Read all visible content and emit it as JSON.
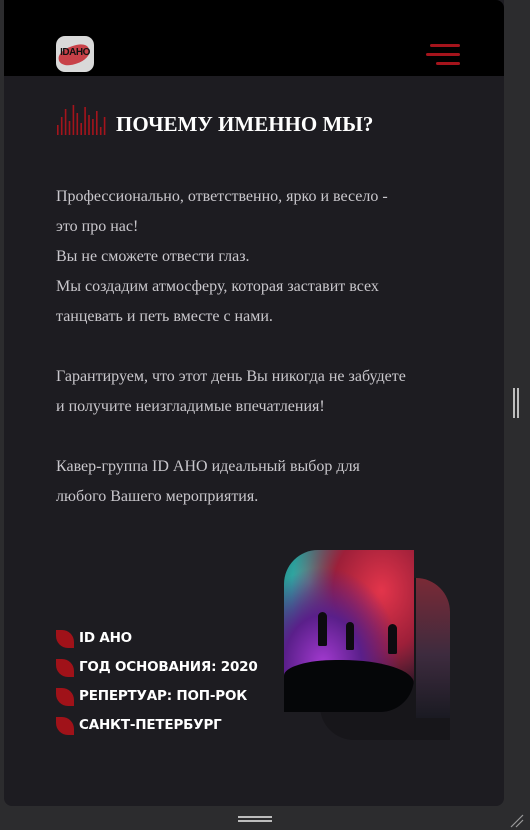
{
  "header": {
    "logo_text": "IDАНО",
    "menu_icon": "hamburger-menu-icon"
  },
  "section": {
    "icon": "equalizer-bars-icon",
    "title": "ПОЧЕМУ ИМЕННО МЫ?"
  },
  "paragraphs": [
    {
      "lines": [
        "Профессионально, ответственно, ярко и весело -",
        "это про нас!",
        "Вы не сможете отвести глаз.",
        "Мы создадим атмосферу, которая заставит всех",
        "танцевать и петь вместе с нами."
      ]
    },
    {
      "lines": [
        "Гарантируем, что этот день Вы никогда не забудете",
        "и получите неизгладимые впечатления!"
      ]
    },
    {
      "lines": [
        "Кавер-группа ID АНО идеальный выбор для",
        "любого Вашего мероприятия."
      ]
    }
  ],
  "facts": [
    "ID АНО",
    "ГОД ОСНОВАНИЯ: 2020",
    "РЕПЕРТУАР: ПОП-РОК",
    "САНКТ-ПЕТЕРБУРГ"
  ],
  "photo": {
    "icon": "concert-stage-photo"
  },
  "colors": {
    "accent": "#a5141c",
    "background": "#1d1c21",
    "header": "#000000",
    "text": "#c9c7cc",
    "heading": "#ffffff"
  }
}
